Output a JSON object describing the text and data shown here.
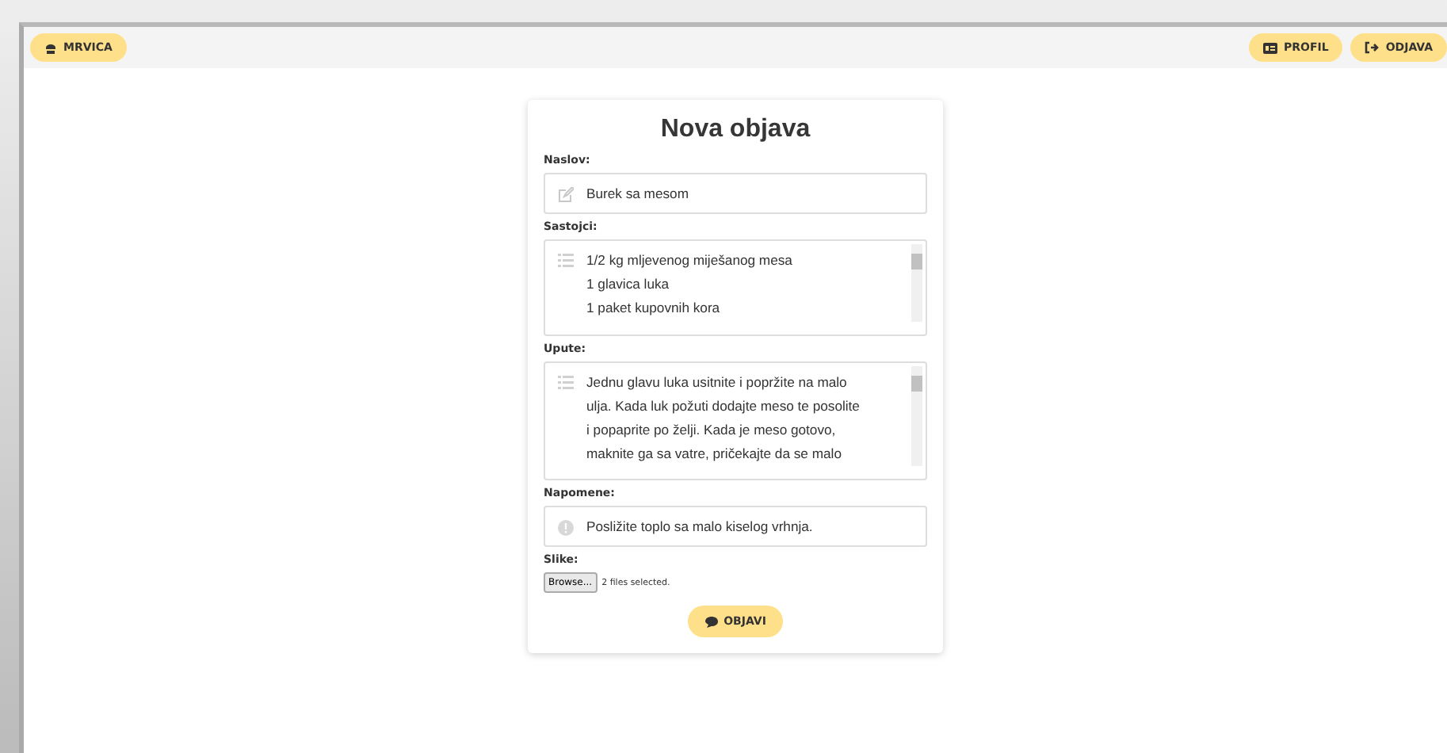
{
  "navbar": {
    "brand": "MRVICA",
    "actions": [
      {
        "label": "PROFIL",
        "kind": "card"
      },
      {
        "label": "ODJAVA",
        "kind": "logout"
      }
    ]
  },
  "form": {
    "title": "Nova objava",
    "fields": [
      {
        "label": "Naslov:",
        "kind": "edit",
        "scrollable": false,
        "lines": [
          "Burek sa mesom"
        ]
      },
      {
        "label": "Sastojci:",
        "kind": "list",
        "scrollable": true,
        "lines": [
          "1/2 kg mljevenog miješanog mesa",
          "1 glavica luka",
          "1 paket kupovnih kora"
        ]
      },
      {
        "label": "Upute:",
        "kind": "list",
        "scrollable": true,
        "lines": [
          "Jednu glavu luka usitnite i popržite na malo",
          "ulja. Kada luk požuti dodajte meso te posolite",
          "i popaprite po želji. Kada je meso gotovo,",
          "maknite ga sa vatre, pričekajte da se malo"
        ]
      },
      {
        "label": "Napomene:",
        "kind": "info",
        "scrollable": false,
        "lines": [
          "Posližite toplo sa malo kiselog vrhnja."
        ]
      }
    ],
    "images": {
      "label": "Slike:",
      "button": "Browse...",
      "status": "2 files selected."
    },
    "submit": "OBJAVI"
  }
}
